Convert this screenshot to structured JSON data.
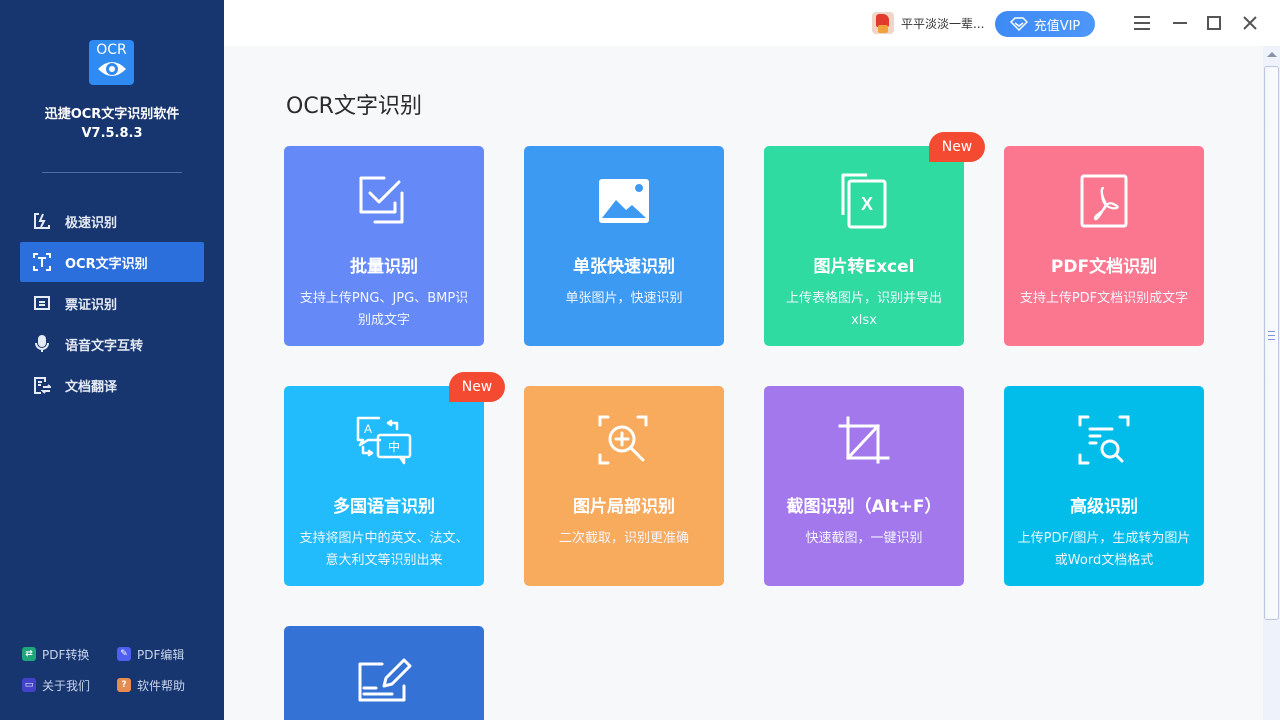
{
  "app": {
    "name": "迅捷OCR文字识别软件",
    "version": "V7.5.8.3",
    "logo_text": "OCR"
  },
  "sidebar": {
    "items": [
      {
        "label": "极速识别",
        "icon": "lightning-frame-icon",
        "active": false
      },
      {
        "label": "OCR文字识别",
        "icon": "text-scan-icon",
        "active": true
      },
      {
        "label": "票证识别",
        "icon": "ticket-icon",
        "active": false
      },
      {
        "label": "语音文字互转",
        "icon": "microphone-icon",
        "active": false
      },
      {
        "label": "文档翻译",
        "icon": "document-translate-icon",
        "active": false
      }
    ],
    "bottom_links": [
      {
        "label": "PDF转换",
        "icon": "pdf-convert-icon",
        "color": "#1fa57a"
      },
      {
        "label": "PDF编辑",
        "icon": "pdf-edit-icon",
        "color": "#4f5ff0"
      },
      {
        "label": "关于我们",
        "icon": "about-chat-icon",
        "color": "#4343c9"
      },
      {
        "label": "软件帮助",
        "icon": "help-question-icon",
        "color": "#e58c50"
      }
    ]
  },
  "header": {
    "username": "平平淡淡一辈...",
    "vip_label": "充值VIP",
    "menu_icon": "hamburger-menu-icon",
    "minimize_icon": "minimize-icon",
    "maximize_icon": "maximize-icon",
    "close_icon": "close-icon"
  },
  "main": {
    "title": "OCR文字识别",
    "badge_label": "New",
    "cards": [
      {
        "title": "批量识别",
        "desc": "支持上传PNG、JPG、BMP识别成文字",
        "color": "#6689f8",
        "icon": "batch-check-icon",
        "new": false
      },
      {
        "title": "单张快速识别",
        "desc": "单张图片，快速识别",
        "color": "#3d9af3",
        "icon": "image-icon",
        "new": false
      },
      {
        "title": "图片转Excel",
        "desc": "上传表格图片，识别并导出xlsx",
        "color": "#2fdba0",
        "icon": "excel-icon",
        "new": true
      },
      {
        "title": "PDF文档识别",
        "desc": "支持上传PDF文档识别成文字",
        "color": "#fb778f",
        "icon": "pdf-icon",
        "new": false
      },
      {
        "title": "多国语言识别",
        "desc": "支持将图片中的英文、法文、意大利文等识别出来",
        "color": "#22bcfd",
        "icon": "language-translate-icon",
        "new": true
      },
      {
        "title": "图片局部识别",
        "desc": "二次截取，识别更准确",
        "color": "#f8aa5d",
        "icon": "zoom-region-icon",
        "new": false
      },
      {
        "title": "截图识别（Alt+F）",
        "desc": "快速截图，一键识别",
        "color": "#a478ed",
        "icon": "crop-icon",
        "new": false
      },
      {
        "title": "高级识别",
        "desc": "上传PDF/图片，生成转为图片或Word文档格式",
        "color": "#02bdea",
        "icon": "advanced-scan-icon",
        "new": false
      },
      {
        "title": "",
        "desc": "",
        "color": "#3572d6",
        "icon": "handwriting-edit-icon",
        "new": false
      }
    ]
  }
}
